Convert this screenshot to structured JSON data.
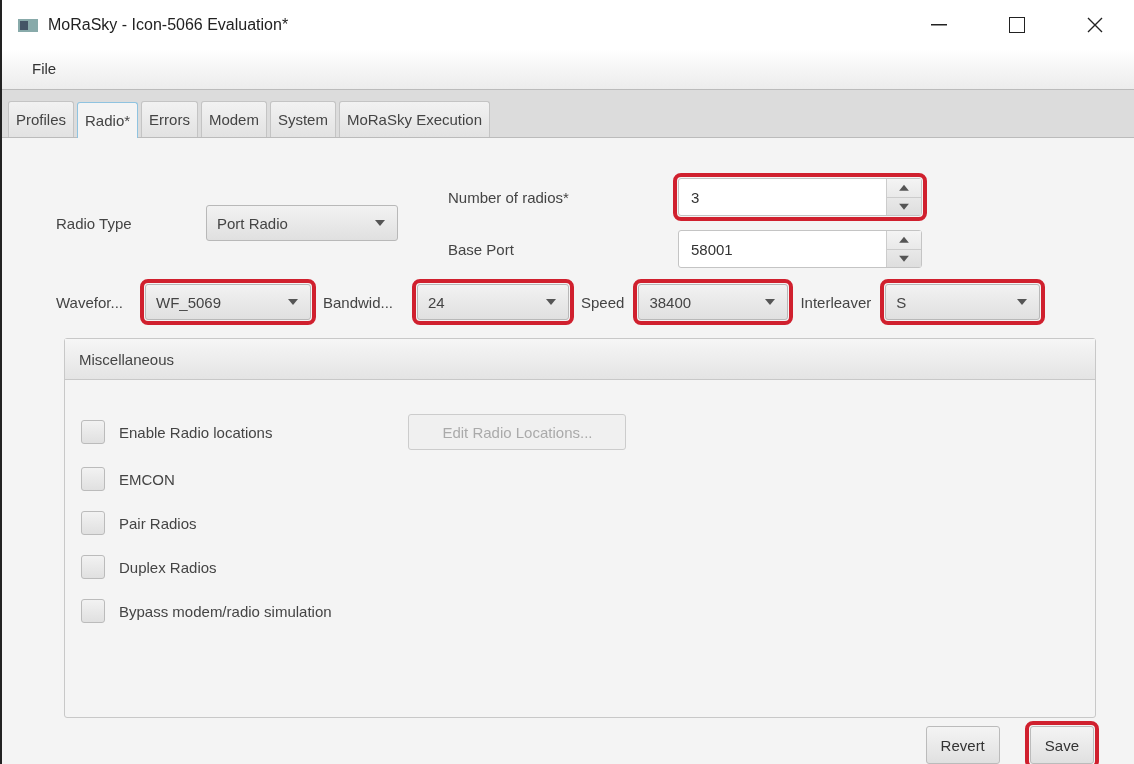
{
  "window": {
    "title": "MoRaSky - Icon-5066 Evaluation*"
  },
  "menu": [
    "File"
  ],
  "tabs": [
    {
      "label": "Profiles",
      "selected": false
    },
    {
      "label": "Radio*",
      "selected": true
    },
    {
      "label": "Errors",
      "selected": false
    },
    {
      "label": "Modem",
      "selected": false
    },
    {
      "label": "System",
      "selected": false
    },
    {
      "label": "MoRaSky Execution",
      "selected": false
    }
  ],
  "radio_type": {
    "label": "Radio Type",
    "value": "Port Radio",
    "highlighted": false
  },
  "number_of_radios": {
    "label": "Number of radios*",
    "value": "3",
    "highlighted": true
  },
  "base_port": {
    "label": "Base Port",
    "value": "58001",
    "highlighted": false
  },
  "selectors": [
    {
      "label": "Wavefor...",
      "value": "WF_5069",
      "highlighted": true
    },
    {
      "label": "Bandwid...",
      "value": "24",
      "highlighted": true
    },
    {
      "label": "Speed",
      "value": "38400",
      "highlighted": true
    },
    {
      "label": "Interleaver",
      "value": "S",
      "highlighted": true
    }
  ],
  "miscellaneous": {
    "title": "Miscellaneous",
    "edit_button": {
      "label": "Edit Radio Locations...",
      "disabled": true
    },
    "options": [
      {
        "label": "Enable Radio locations",
        "checked": false
      },
      {
        "label": "EMCON",
        "checked": false
      },
      {
        "label": "Pair Radios",
        "checked": false
      },
      {
        "label": "Duplex Radios",
        "checked": false
      },
      {
        "label": "Bypass modem/radio simulation",
        "checked": false
      }
    ]
  },
  "buttons": [
    {
      "label": "Revert",
      "highlighted": false
    },
    {
      "label": "Save",
      "highlighted": true
    }
  ]
}
